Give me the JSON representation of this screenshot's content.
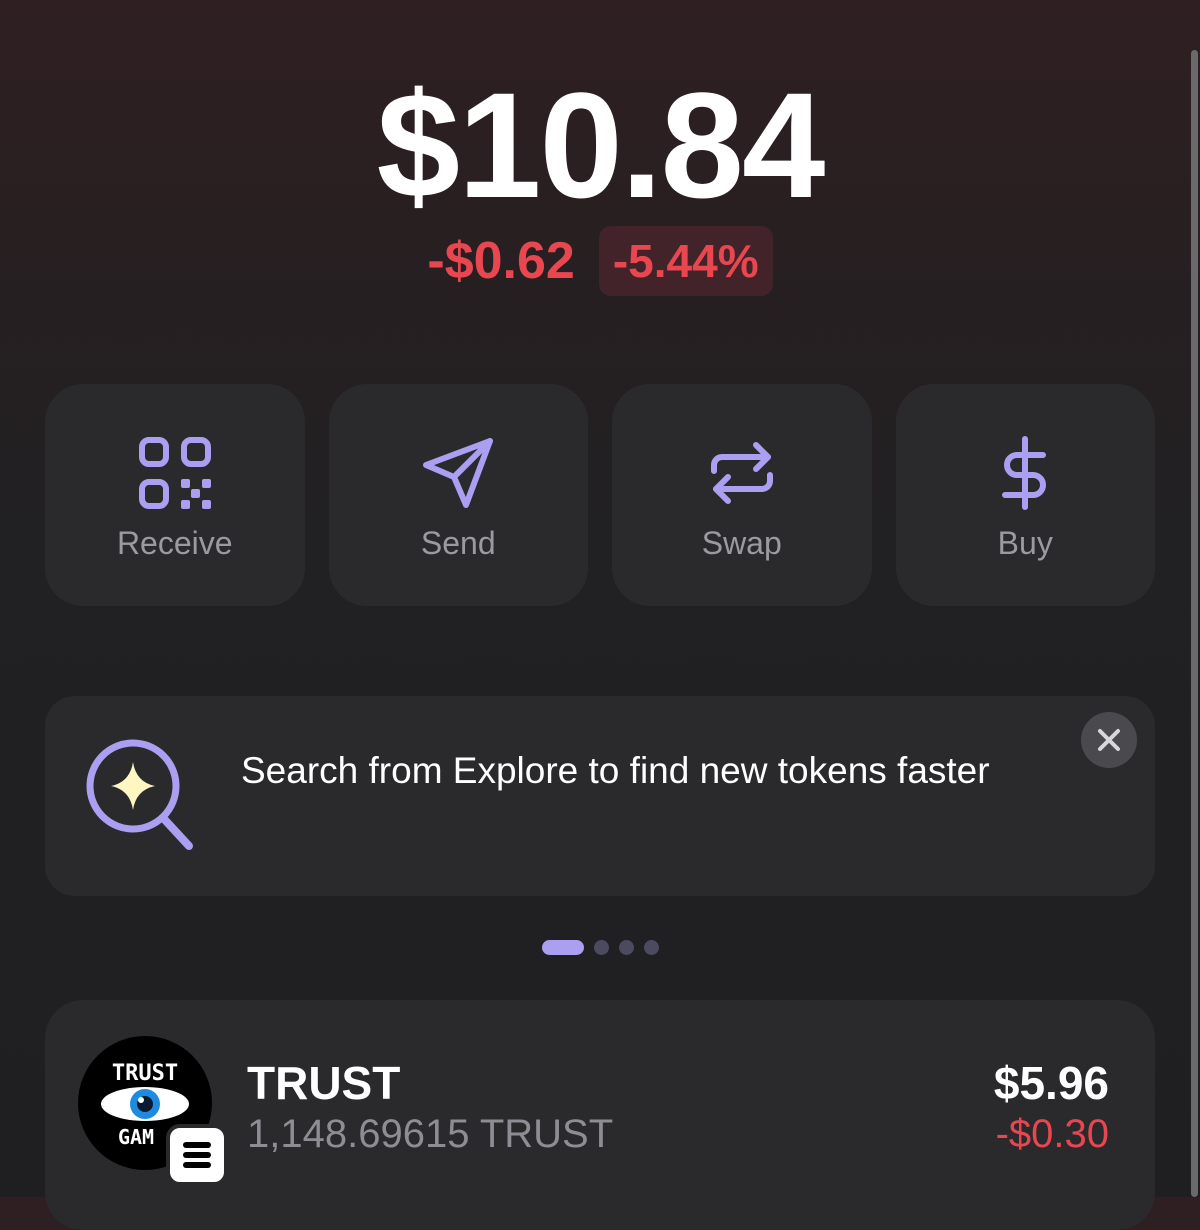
{
  "balance": {
    "total": "$10.84",
    "change_amount": "-$0.62",
    "change_percent": "-5.44%"
  },
  "actions": [
    {
      "label": "Receive",
      "icon": "qr-code-icon"
    },
    {
      "label": "Send",
      "icon": "send-icon"
    },
    {
      "label": "Swap",
      "icon": "swap-icon"
    },
    {
      "label": "Buy",
      "icon": "dollar-icon"
    }
  ],
  "banner": {
    "text": "Search from Explore to find new tokens faster",
    "icon": "search-sparkle-icon",
    "close_icon": "close-icon"
  },
  "pagination": {
    "total": 4,
    "active": 1
  },
  "tokens": [
    {
      "name": "TRUST",
      "amount": "1,148.69615 TRUST",
      "value": "$5.96",
      "change": "-$0.30",
      "logo_text_top": "TRUST",
      "logo_text_bottom": "GAM",
      "network_badge": "solana-icon"
    }
  ],
  "colors": {
    "accent": "#ab9ff2",
    "negative": "#e8474f",
    "card": "#2a2a2d",
    "muted_text": "#9a9aa0"
  }
}
